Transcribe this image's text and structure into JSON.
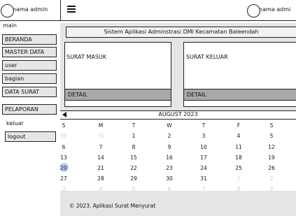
{
  "topbar": {
    "admin_label_left": "nama admin",
    "menu_icon": "hamburger-icon",
    "admin_label_right": "nama admi"
  },
  "sidebar": {
    "section_main": "main",
    "items": [
      {
        "label": "BERANDA"
      },
      {
        "label": "MASTER DATA"
      },
      {
        "label": "user"
      },
      {
        "label": "bagian"
      },
      {
        "label": "DATA SURAT"
      },
      {
        "label": "PELAPORAN"
      }
    ],
    "section_keluar": "keluar",
    "logout_label": "logout"
  },
  "header": {
    "title": "Sistem Aplikasi Adminstrasi DMI Kecamatan Baleendah"
  },
  "cards": [
    {
      "title": "SURAT MASUK",
      "detail": "DETAIL"
    },
    {
      "title": "SURAT KELUAR",
      "detail": "DETAIL"
    }
  ],
  "calendar": {
    "prev_icon": "triangle-left-icon",
    "month": "AUGUST 2023",
    "weekdays": [
      "S",
      "M",
      "T",
      "W",
      "T",
      "F",
      "S"
    ],
    "rows": [
      [
        {
          "d": "30",
          "m": true
        },
        {
          "d": "31",
          "m": true
        },
        {
          "d": "1"
        },
        {
          "d": "2"
        },
        {
          "d": "3"
        },
        {
          "d": "4"
        },
        {
          "d": "5"
        }
      ],
      [
        {
          "d": "6"
        },
        {
          "d": "7"
        },
        {
          "d": "8"
        },
        {
          "d": "9"
        },
        {
          "d": "10"
        },
        {
          "d": "11"
        },
        {
          "d": "12"
        }
      ],
      [
        {
          "d": "13"
        },
        {
          "d": "14"
        },
        {
          "d": "15"
        },
        {
          "d": "16"
        },
        {
          "d": "17"
        },
        {
          "d": "18"
        },
        {
          "d": "19"
        }
      ],
      [
        {
          "d": "20",
          "sel": true
        },
        {
          "d": "21"
        },
        {
          "d": "22"
        },
        {
          "d": "23"
        },
        {
          "d": "24"
        },
        {
          "d": "25"
        },
        {
          "d": "26"
        }
      ],
      [
        {
          "d": "27"
        },
        {
          "d": "28"
        },
        {
          "d": "29"
        },
        {
          "d": "30"
        },
        {
          "d": "31"
        },
        {
          "d": "1",
          "m": true
        },
        {
          "d": "2",
          "m": true
        }
      ],
      [
        {
          "d": "3",
          "m": true
        },
        {
          "d": "4",
          "m": true
        },
        {
          "d": "5",
          "m": true
        },
        {
          "d": "6",
          "m": true
        },
        {
          "d": "7",
          "m": true
        },
        {
          "d": "8",
          "m": true
        },
        {
          "d": "9",
          "m": true
        }
      ]
    ],
    "selected_color": "#b9cdf0"
  },
  "footer": {
    "text": "© 2023. Aplikasi Surat Menyurat"
  }
}
